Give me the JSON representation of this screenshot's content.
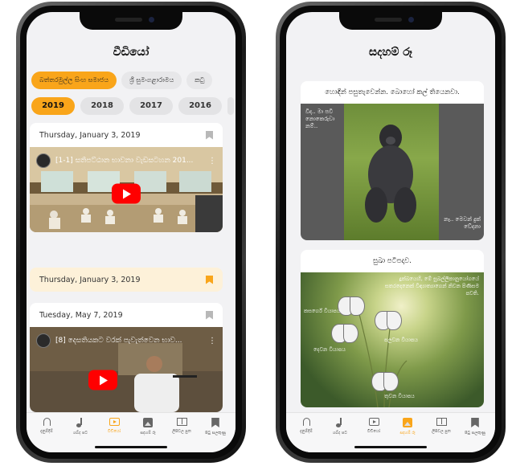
{
  "left": {
    "title": "වීඩියෝ",
    "channels": [
      "බත්තරමුල්ල සිංහ සමාජය",
      "ශ්‍රී සුමංගළාරාමය",
      "කටු"
    ],
    "years": [
      "2019",
      "2018",
      "2017",
      "2016"
    ],
    "videos": [
      {
        "date": "Thursday, January 3, 2019",
        "title": "[1-1] සතිපට්ඨාන භාවනා වැඩසටහන 201...",
        "bookmarked": false
      },
      {
        "date": "Thursday, January 3, 2019",
        "bookmarked": true
      },
      {
        "date": "Tuesday, May 7, 2019",
        "title": "[8] දෙසතියකට වරක් පැවැත්වෙන භාව...",
        "bookmarked": false
      }
    ]
  },
  "right": {
    "title": "සදහම් රූ",
    "card1": {
      "heading": "හොඳින් පසුතැවෙන්න. බොහෝ කල් තියෙනවා.",
      "left_text": "විද.. මා පවි නොකෙරුවා නම්..",
      "right_text": "නෑ.. මෙවන් දුක් වේදනා"
    },
    "card2": {
      "heading": "සුඛා පටිපදාව.",
      "overlay": "දුක්ඛයෙහි, මේ සුඛල්ලිකානුයෝගයේ සතරදෙනෙක් විඳ්‍යාත්‍යාගෙන් නිවන පිණිසම පවති.",
      "labels": [
        "කසර්ගේ වියාපය",
        "පලවන වියාපය",
        "දෙවන වියාපය",
        "තුවන වියාපය"
      ]
    }
  },
  "tabs": [
    {
      "icon": "bell-icon",
      "label": "දැනුම්දීම්"
    },
    {
      "icon": "music-note-icon",
      "label": "ශබ්ද පට"
    },
    {
      "icon": "video-icon",
      "label": "වීඩියෝ"
    },
    {
      "icon": "image-icon",
      "label": "සදහම් රූ"
    },
    {
      "icon": "book-icon",
      "label": "ලිපිවල පුත"
    },
    {
      "icon": "bookmark-icon",
      "label": "පිටු සලකුණු"
    }
  ],
  "colors": {
    "accent": "#f9a51a",
    "youtube": "#ff0000"
  }
}
